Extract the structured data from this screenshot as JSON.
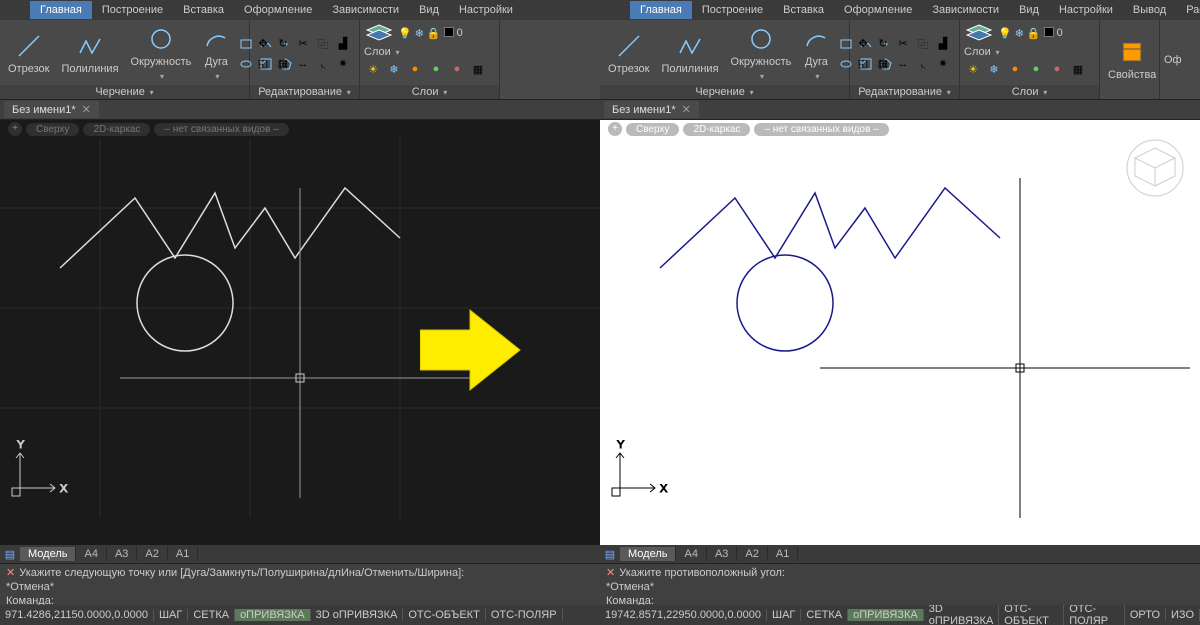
{
  "tabs": [
    "Главная",
    "Построение",
    "Вставка",
    "Оформление",
    "Зависимости",
    "Вид",
    "Настройки",
    "Вывод",
    "Растр"
  ],
  "tabs_right": [
    "Главная",
    "Построение",
    "Вставка",
    "Оформление",
    "Зависимости",
    "Вид",
    "Настройки",
    "Вывод",
    "Растр"
  ],
  "tools": {
    "segment": "Отрезок",
    "polyline": "Полилиния",
    "circle": "Окружность",
    "arc": "Дуга"
  },
  "panels": {
    "draw": "Черчение",
    "edit": "Редактирование",
    "layers": "Слои",
    "props": "Свойства",
    "of": "Оф"
  },
  "layers_label": "Слои",
  "layer_current": "0",
  "doc": "Без имени1*",
  "pills": [
    "Сверху",
    "2D-каркас",
    "– нет связанных видов –"
  ],
  "modeltabs": [
    "Модель",
    "A4",
    "A3",
    "A2",
    "A1"
  ],
  "cmd_left": "Укажите следующую точку или [Дуга/Замкнуть/Полуширина/длИна/Отменить/Ширина]:\n*Отмена*\nКоманда:",
  "cmd_right": "Укажите противоположный угол:\n*Отмена*\nКоманда:",
  "coords_left": "971.4286,21150.0000,0.0000",
  "coords_right": "19742.8571,22950.0000,0.0000",
  "status_btns": [
    "ШАГ",
    "СЕТКА",
    "оПРИВЯЗКА",
    "3D оПРИВЯЗКА",
    "ОТС-ОБЪЕКТ",
    "ОТС-ПОЛЯР",
    "ОРТО",
    "ИЗО"
  ],
  "axis": {
    "x": "X",
    "y": "Y"
  }
}
